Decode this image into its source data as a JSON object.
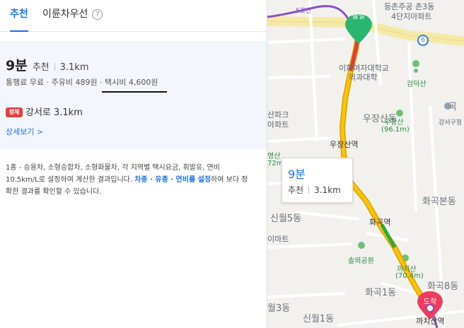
{
  "tabs": [
    {
      "label": "추천",
      "active": true
    },
    {
      "label": "이륜차우선",
      "active": false
    }
  ],
  "route": {
    "time": "9분",
    "type": "추천",
    "distance": "3.1km",
    "costs": "통행료 무료 · 주유비 489원 · 택시비 4,600원",
    "congestion_badge": "정체",
    "congested_road": "강서로 3.1km",
    "detail_link": "상세보기 >"
  },
  "note": {
    "text_before": "1종 - 승용차, 소형승합차, 소형화물차, 각 지역별 택시요금, 휘발유, 연비 10.5km/L로 설정하여 계산한 결과입니다. ",
    "highlight": "차종 · 유종 · 연비를 설정",
    "text_after": "하여 보다 정확한 결과를 확인할 수 있습니다."
  },
  "map": {
    "start_label": "출발",
    "end_label": "도착",
    "bubble_time": "9분",
    "bubble_type": "추천",
    "bubble_distance": "3.1km",
    "labels": {
      "line5": "5호선",
      "apt_top": "등촌주공 촌3동",
      "apt_top2": "4단지아파트",
      "road_no": "6",
      "hospital": "이화여자대학교",
      "hospital2": "의과대학",
      "geomdeok": "검덕산",
      "ujangsan_dong": "우장산동",
      "ujangsan_park": "우장산",
      "ujangsan_height": "(96.1m)",
      "gangseo": "강서구청",
      "hwagok_left1": "산파크",
      "hwagok_left2": "아파트",
      "ujangsan_station": "우장산역",
      "myeongsan": "명산",
      "m72": "72m",
      "hwagok_bon": "화곡본동",
      "sinwol5": "신월5동",
      "emart": "이마트",
      "hwagok_station": "화곡역",
      "solmoe": "솔뫼공원",
      "kkachi": "까치산",
      "kkachi_h": "(70.4m)",
      "hwagok8": "화곡8동",
      "hwagok1": "화곡1동",
      "wol3": "월3동",
      "sinwol1": "신월1동",
      "kkachisan_station": "까치산역",
      "gok": "곡"
    }
  }
}
